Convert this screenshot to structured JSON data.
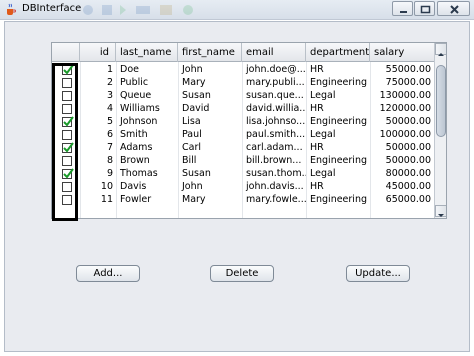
{
  "window": {
    "title": "DBInterface"
  },
  "table": {
    "columns": [
      "",
      "id",
      "last_name",
      "first_name",
      "email",
      "department",
      "salary"
    ],
    "rows": [
      {
        "checked": true,
        "id": "1",
        "last_name": "Doe",
        "first_name": "John",
        "email": "john.doe@...",
        "department": "HR",
        "salary": "55000.00"
      },
      {
        "checked": false,
        "id": "2",
        "last_name": "Public",
        "first_name": "Mary",
        "email": "mary.publi...",
        "department": "Engineering",
        "salary": "75000.00"
      },
      {
        "checked": false,
        "id": "3",
        "last_name": "Queue",
        "first_name": "Susan",
        "email": "susan.que...",
        "department": "Legal",
        "salary": "130000.00"
      },
      {
        "checked": false,
        "id": "4",
        "last_name": "Williams",
        "first_name": "David",
        "email": "david.willia...",
        "department": "HR",
        "salary": "120000.00"
      },
      {
        "checked": true,
        "id": "5",
        "last_name": "Johnson",
        "first_name": "Lisa",
        "email": "lisa.johnso...",
        "department": "Engineering",
        "salary": "50000.00"
      },
      {
        "checked": false,
        "id": "6",
        "last_name": "Smith",
        "first_name": "Paul",
        "email": "paul.smith...",
        "department": "Legal",
        "salary": "100000.00"
      },
      {
        "checked": true,
        "id": "7",
        "last_name": "Adams",
        "first_name": "Carl",
        "email": "carl.adam...",
        "department": "HR",
        "salary": "50000.00"
      },
      {
        "checked": false,
        "id": "8",
        "last_name": "Brown",
        "first_name": "Bill",
        "email": "bill.brown...",
        "department": "Engineering",
        "salary": "50000.00"
      },
      {
        "checked": true,
        "id": "9",
        "last_name": "Thomas",
        "first_name": "Susan",
        "email": "susan.thom...",
        "department": "Legal",
        "salary": "80000.00"
      },
      {
        "checked": false,
        "id": "10",
        "last_name": "Davis",
        "first_name": "John",
        "email": "john.davis...",
        "department": "HR",
        "salary": "45000.00"
      },
      {
        "checked": false,
        "id": "11",
        "last_name": "Fowler",
        "first_name": "Mary",
        "email": "mary.fowle...",
        "department": "Engineering",
        "salary": "65000.00"
      }
    ]
  },
  "buttons": {
    "add": "Add...",
    "delete": "Delete",
    "update": "Update..."
  },
  "colors": {
    "panel_bg": "#e9ebf0",
    "check_green": "#1a9a2a"
  },
  "icons": {
    "app": "java-cup-icon",
    "minimize": "minimize-icon",
    "maximize": "maximize-icon",
    "close": "close-icon"
  }
}
